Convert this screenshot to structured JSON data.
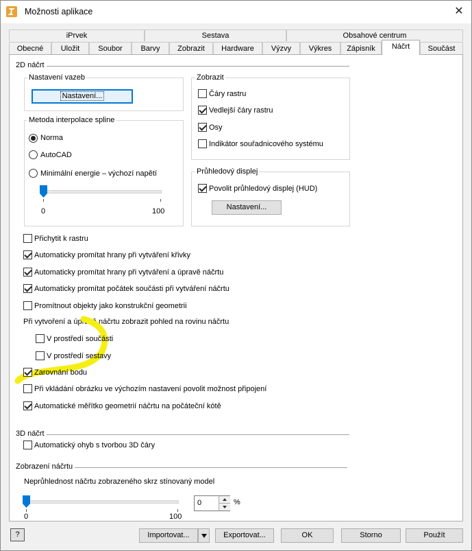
{
  "window": {
    "title": "Možnosti aplikace",
    "close_symbol": "✕"
  },
  "tabs_top": [
    "iPrvek",
    "Sestava",
    "Obsahové centrum"
  ],
  "tabs_bottom": [
    "Obecné",
    "Uložit",
    "Soubor",
    "Barvy",
    "Zobrazit",
    "Hardware",
    "Výzvy",
    "Výkres",
    "Zápisník",
    "Náčrt",
    "Součást"
  ],
  "active_tab": "Náčrt",
  "sketch2d": {
    "title": "2D náčrt",
    "constraints": {
      "title": "Nastavení vazeb",
      "button": "Nastavení..."
    },
    "spline": {
      "title": "Metoda interpolace spline",
      "options": [
        "Norma",
        "AutoCAD",
        "Minimální energie – výchozí napětí"
      ],
      "selected": 0,
      "slider": {
        "min": "0",
        "max": "100",
        "value": 0
      }
    },
    "display": {
      "title": "Zobrazit",
      "items": [
        {
          "label": "Čáry rastru",
          "checked": false
        },
        {
          "label": "Vedlejší čáry rastru",
          "checked": true
        },
        {
          "label": "Osy",
          "checked": true
        },
        {
          "label": "Indikátor souřadnicového systému",
          "checked": false
        }
      ]
    },
    "hud": {
      "title": "Průhledový displej",
      "enable": {
        "label": "Povolit průhledový displej (HUD)",
        "checked": true
      },
      "button": "Nastavení..."
    },
    "options": [
      {
        "label": "Přichytit k rastru",
        "checked": false
      },
      {
        "label": "Automaticky promítat hrany při vytváření křivky",
        "checked": true
      },
      {
        "label": "Automaticky promítat hrany při vytváření a úpravě náčrtu",
        "checked": true
      },
      {
        "label": "Automaticky promítat počátek součásti při vytváření náčrtu",
        "checked": true
      },
      {
        "label": "Promítnout objekty jako konstrukční geometrii",
        "checked": false
      }
    ],
    "view_heading": "Při vytvoření a úpravě náčrtu zobrazit pohled na rovinu náčrtu",
    "view_options": [
      {
        "label": "V prostředí součásti",
        "checked": false
      },
      {
        "label": "V prostředí sestavy",
        "checked": false
      }
    ],
    "options2": [
      {
        "label": "Zarovnání bodu",
        "checked": true
      },
      {
        "label": "Při vkládání obrázku ve výchozím nastavení povolit možnost připojení",
        "checked": false
      },
      {
        "label": "Automatické měřítko geometrií náčrtu na počáteční kótě",
        "checked": true
      }
    ]
  },
  "sketch3d": {
    "title": "3D náčrt",
    "auto_bend": {
      "label": "Automatický ohyb s tvorbou 3D čáry",
      "checked": false
    }
  },
  "sketch_display": {
    "title": "Zobrazení náčrtu",
    "opacity_label": "Neprůhlednost náčrtu zobrazeného skrz stínovaný model",
    "slider": {
      "min": "0",
      "max": "100",
      "value": 0
    },
    "value": "0",
    "unit": "%"
  },
  "footer": {
    "help": "?",
    "import": "Importovat...",
    "export": "Exportovat...",
    "ok": "OK",
    "cancel": "Storno",
    "apply": "Použít"
  },
  "colors": {
    "highlight": "#f5ee14",
    "accent": "#0078d7",
    "slider_thumb": "#0078d7"
  }
}
